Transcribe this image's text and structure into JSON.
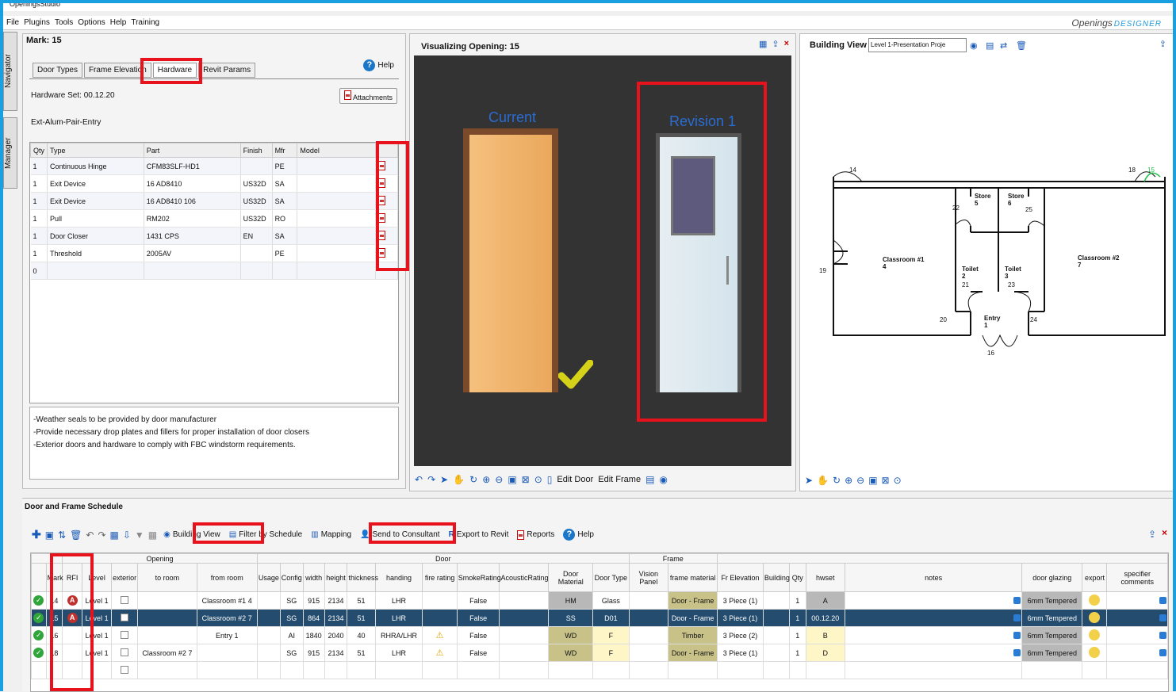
{
  "window": {
    "title": "OpeningsStudio"
  },
  "menu": [
    "File",
    "Plugins",
    "Tools",
    "Options",
    "Help",
    "Training"
  ],
  "brand": {
    "main": "Openings",
    "sub": "DESIGNER"
  },
  "side_tabs": [
    "Navigator",
    "Manager"
  ],
  "left": {
    "mark": "Mark: 15",
    "tabs": [
      "Door Types",
      "Frame Elevation",
      "Hardware",
      "Revit Params"
    ],
    "help": "Help",
    "hardware_set": "Hardware Set: 00.12.20",
    "attachments": "Attachments",
    "set_name": "Ext-Alum-Pair-Entry",
    "columns": [
      "Qty",
      "Type",
      "Part",
      "Finish",
      "Mfr",
      "Model"
    ],
    "rows": [
      [
        "1",
        "Continuous Hinge",
        "CFM83SLF-HD1",
        "",
        "PE",
        ""
      ],
      [
        "1",
        "Exit Device",
        "16 AD8410",
        "US32D",
        "SA",
        ""
      ],
      [
        "1",
        "Exit Device",
        "16 AD8410 106",
        "US32D",
        "SA",
        ""
      ],
      [
        "1",
        "Pull",
        "RM202",
        "US32D",
        "RO",
        ""
      ],
      [
        "1",
        "Door Closer",
        "1431 CPS",
        "EN",
        "SA",
        ""
      ],
      [
        "1",
        "Threshold",
        "2005AV",
        "",
        "PE",
        ""
      ],
      [
        "0",
        "",
        "",
        "",
        "",
        ""
      ]
    ],
    "notes": [
      "-Weather seals to be provided  by door manufacturer",
      "-Provide necessary drop plates and fillers for proper installation of door closers",
      "-Exterior doors and hardware to comply with FBC windstorm requirements."
    ]
  },
  "viz": {
    "title": "Visualizing Opening: 15",
    "current_label": "Current",
    "revision_label": "Revision 1",
    "edit_door": "Edit Door",
    "edit_frame": "Edit Frame"
  },
  "building": {
    "title": "Building View",
    "view_select": "Level 1-Presentation Proje",
    "rooms": {
      "store5": "Store\n5",
      "store6": "Store\n6",
      "classroom1": "Classroom #1",
      "classroom1_num": "4",
      "classroom2": "Classroom #2",
      "classroom2_num": "7",
      "toilet2": "Toilet",
      "toilet2_num": "2",
      "toilet3": "Toilet",
      "toilet3_num": "3",
      "entry": "Entry",
      "entry_num": "1"
    },
    "door_tags": [
      "14",
      "18",
      "15",
      "22",
      "25",
      "19",
      "21",
      "23",
      "20",
      "24",
      "16"
    ]
  },
  "schedule": {
    "title": "Door and Frame Schedule",
    "toolbar": {
      "building_view": "Building View",
      "filter": "Filter by Schedule",
      "mapping": "Mapping",
      "send": "Send to Consultant",
      "export": "Export to Revit",
      "reports": "Reports",
      "help": "Help"
    },
    "groups": {
      "opening": "Opening",
      "door": "Door",
      "frame": "Frame"
    },
    "columns": [
      "Mark",
      "RFI",
      "Level",
      "exterior",
      "to room",
      "from room",
      "Usage",
      "Config",
      "width",
      "height",
      "thickness",
      "handing",
      "fire rating",
      "SmokeRating",
      "AcousticRating",
      "Door Material",
      "Door Type",
      "Vision Panel",
      "frame material",
      "Fr Elevation",
      "Building",
      "Qty",
      "hwset",
      "notes",
      "door glazing",
      "export",
      "specifier comments"
    ],
    "rows": [
      {
        "mark": "14",
        "rfi": "A",
        "level": "Level 1",
        "to_room": "",
        "from_room": "Classroom #1 4",
        "config": "SG",
        "width": "915",
        "height": "2134",
        "thickness": "51",
        "handing": "LHR",
        "fire": "",
        "smoke": "False",
        "door_mat": "HM",
        "door_type": "Glass",
        "frame_mat": "Door - Frame",
        "fr_elev": "3 Piece (1)",
        "qty": "1",
        "hwset": "A",
        "glazing": "6mm Tempered"
      },
      {
        "mark": "15",
        "rfi": "A",
        "level": "Level 1",
        "to_room": "",
        "from_room": "Classroom #2 7",
        "config": "SG",
        "width": "864",
        "height": "2134",
        "thickness": "51",
        "handing": "LHR",
        "fire": "",
        "smoke": "False",
        "door_mat": "SS",
        "door_type": "D01",
        "frame_mat": "Door - Frame",
        "fr_elev": "3 Piece (1)",
        "qty": "1",
        "hwset": "00.12.20",
        "glazing": "6mm Tempered"
      },
      {
        "mark": "16",
        "rfi": "",
        "level": "Level 1",
        "to_room": "",
        "from_room": "Entry 1",
        "config": "AI",
        "width": "1840",
        "height": "2040",
        "thickness": "40",
        "handing": "RHRA/LHR",
        "fire": "warn",
        "smoke": "False",
        "door_mat": "WD",
        "door_type": "F",
        "frame_mat": "Timber",
        "fr_elev": "3 Piece (2)",
        "qty": "1",
        "hwset": "B",
        "glazing": "6mm Tempered"
      },
      {
        "mark": "18",
        "rfi": "",
        "level": "Level 1",
        "to_room": "Classroom #2 7",
        "from_room": "",
        "config": "SG",
        "width": "915",
        "height": "2134",
        "thickness": "51",
        "handing": "LHR",
        "fire": "warn",
        "smoke": "False",
        "door_mat": "WD",
        "door_type": "F",
        "frame_mat": "Door - Frame",
        "fr_elev": "3 Piece (1)",
        "qty": "1",
        "hwset": "D",
        "glazing": "6mm Tempered"
      }
    ]
  },
  "colors": {
    "frame": "#1aa0e0",
    "highlight": "#e8121d",
    "selected_row": "#244c6e"
  }
}
